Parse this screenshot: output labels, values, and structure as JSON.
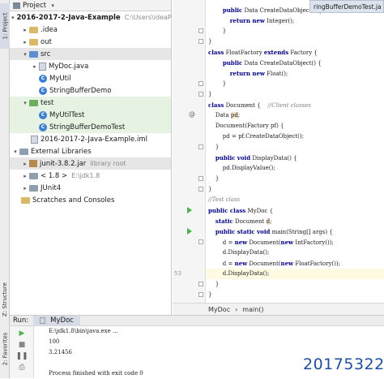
{
  "sidebar": {
    "project_tab": "1: Project",
    "structure_tab": "Z: Structure",
    "favorites_tab": "2: Favorites"
  },
  "project_panel": {
    "title": "Project",
    "tree": [
      {
        "label": "2016-2017-2-Java-Example",
        "extra": "C:\\Users\\ideaP",
        "bold": true
      },
      {
        "label": ".idea"
      },
      {
        "label": "out"
      },
      {
        "label": "src"
      },
      {
        "label": "MyDoc.java"
      },
      {
        "label": "MyUtil"
      },
      {
        "label": "StringBufferDemo"
      },
      {
        "label": "test"
      },
      {
        "label": "MyUtilTest"
      },
      {
        "label": "StringBufferDemoTest"
      },
      {
        "label": "2016-2017-2-Java-Example.iml"
      },
      {
        "label": "External Libraries"
      },
      {
        "label": "junit-3.8.2.jar",
        "extra": "library root"
      },
      {
        "label": "< 1.8 >",
        "extra": "E:\\jdk1.8"
      },
      {
        "label": "JUnit4"
      },
      {
        "label": "Scratches and Consoles"
      }
    ]
  },
  "editor": {
    "tab_label": "ringBufferDemoTest.ja",
    "lines": [
      {
        "num": "",
        "parts": [
          [
            "",
            "        "
          ],
          [
            "kw",
            "public"
          ],
          [
            "",
            " Data CreateDataObject() {"
          ]
        ]
      },
      {
        "num": "",
        "parts": [
          [
            "",
            "            "
          ],
          [
            "kw",
            "return new"
          ],
          [
            "",
            " Integer();"
          ]
        ]
      },
      {
        "num": "",
        "parts": [
          [
            "",
            "        }"
          ]
        ]
      },
      {
        "num": "",
        "parts": [
          [
            "",
            "}"
          ]
        ]
      },
      {
        "num": "",
        "parts": [
          [
            "kw",
            "class"
          ],
          [
            "",
            " FloatFactory "
          ],
          [
            "kw",
            "extends"
          ],
          [
            "",
            " Factory {"
          ]
        ]
      },
      {
        "num": "",
        "parts": [
          [
            "",
            "        "
          ],
          [
            "kw",
            "public"
          ],
          [
            "",
            " Data CreateDataObject() {"
          ]
        ]
      },
      {
        "num": "",
        "parts": [
          [
            "",
            "            "
          ],
          [
            "kw",
            "return new"
          ],
          [
            "",
            " Float();"
          ]
        ]
      },
      {
        "num": "",
        "parts": [
          [
            "",
            "        }"
          ]
        ]
      },
      {
        "num": "",
        "parts": [
          [
            "",
            "}"
          ]
        ]
      },
      {
        "num": "",
        "parts": [
          [
            "kw",
            "class"
          ],
          [
            "",
            " Document {    "
          ],
          [
            "cm",
            "//Client classes"
          ]
        ]
      },
      {
        "num": "",
        "parts": [
          [
            "",
            "    Data "
          ],
          [
            "hl",
            "pd"
          ],
          [
            "",
            ";"
          ]
        ]
      },
      {
        "num": "",
        "parts": [
          [
            "",
            "    Document(Factory pf) {"
          ]
        ]
      },
      {
        "num": "",
        "parts": [
          [
            "",
            "        pd = pf.CreateDataObject();"
          ]
        ]
      },
      {
        "num": "",
        "parts": [
          [
            "",
            "    }"
          ]
        ]
      },
      {
        "num": "",
        "parts": [
          [
            "",
            "    "
          ],
          [
            "kw",
            "public void"
          ],
          [
            "",
            " DisplayData() {"
          ]
        ]
      },
      {
        "num": "",
        "parts": [
          [
            "",
            "        pd.DisplayValue();"
          ]
        ]
      },
      {
        "num": "",
        "parts": [
          [
            "",
            "    }"
          ]
        ]
      },
      {
        "num": "",
        "parts": [
          [
            "",
            "}"
          ]
        ]
      },
      {
        "num": "",
        "parts": [
          [
            "cm",
            "//Test class"
          ]
        ]
      },
      {
        "num": "",
        "parts": [
          [
            "kw",
            "public class"
          ],
          [
            "",
            " MyDoc {"
          ]
        ]
      },
      {
        "num": "",
        "parts": [
          [
            "",
            "    "
          ],
          [
            "kw",
            "static"
          ],
          [
            "",
            " Document "
          ],
          [
            "hl",
            "d"
          ],
          [
            "",
            ";"
          ]
        ]
      },
      {
        "num": "",
        "parts": [
          [
            "",
            "    "
          ],
          [
            "kw",
            "public static void"
          ],
          [
            "",
            " main(String[] args) {"
          ]
        ]
      },
      {
        "num": "",
        "parts": [
          [
            "",
            "        d = "
          ],
          [
            "kw",
            "new"
          ],
          [
            "",
            " Document("
          ],
          [
            "kw",
            "new"
          ],
          [
            "",
            " IntFactory());"
          ]
        ]
      },
      {
        "num": "",
        "parts": [
          [
            "",
            "        d.DisplayData();"
          ]
        ]
      },
      {
        "num": "",
        "parts": [
          [
            "",
            "        d = "
          ],
          [
            "kw",
            "new"
          ],
          [
            "",
            " Document("
          ],
          [
            "kw",
            "new"
          ],
          [
            "",
            " FloatFactory());"
          ]
        ]
      },
      {
        "num": "53",
        "parts": [
          [
            "",
            "        d.DisplayData();"
          ]
        ],
        "current": true
      },
      {
        "num": "",
        "parts": [
          [
            "",
            "    }"
          ]
        ]
      },
      {
        "num": "",
        "parts": [
          [
            "",
            "}"
          ]
        ]
      }
    ]
  },
  "breadcrumb": {
    "items": [
      "MyDoc",
      "main()"
    ]
  },
  "run_panel": {
    "label": "Run:",
    "tab": "MyDoc",
    "console": [
      "E:\\jdk1.8\\bin\\java.exe ...",
      "100",
      "3.21456",
      "",
      "Process finished with exit code 0"
    ]
  },
  "watermark": "20175322"
}
